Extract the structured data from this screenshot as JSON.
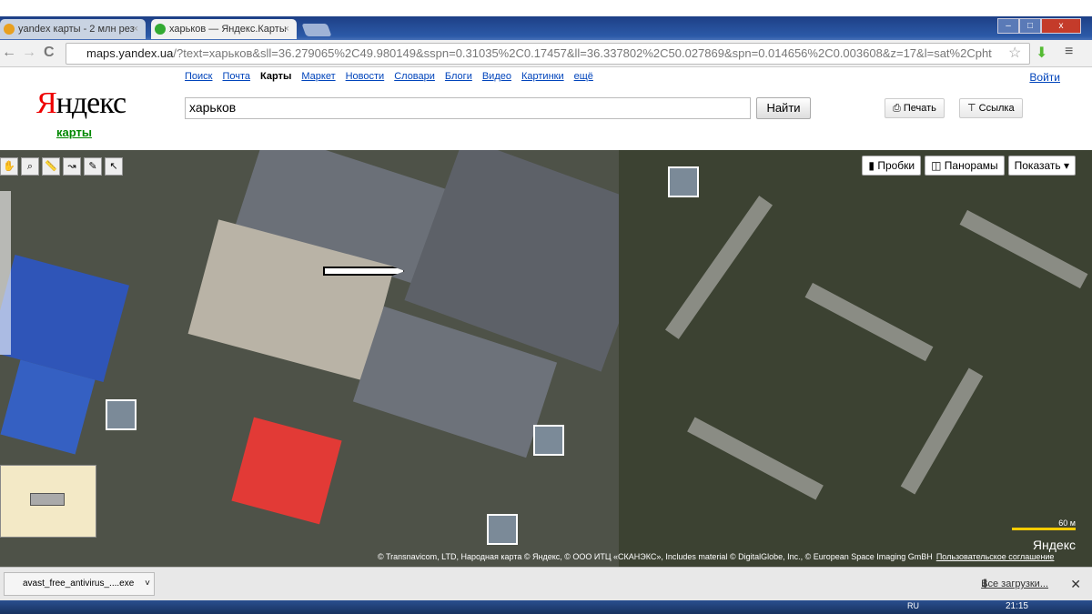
{
  "browser": {
    "tabs": [
      {
        "label": "yandex карты - 2 млн рез"
      },
      {
        "label": "харьков — Яндекс.Карты"
      }
    ],
    "url_host": "maps.yandex.ua",
    "url_rest": "/?text=харьков&sll=36.279065%2C49.980149&sspn=0.31035%2C0.17457&ll=36.337802%2C50.027869&spn=0.014656%2C0.003608&z=17&l=sat%2Cpht"
  },
  "header": {
    "logo": "Яндекс",
    "logo_first": "Я",
    "logo_rest": "ндекс",
    "subtitle": "карты",
    "services": [
      "Поиск",
      "Почта",
      "Карты",
      "Маркет",
      "Новости",
      "Словари",
      "Блоги",
      "Видео",
      "Картинки",
      "ещё"
    ],
    "login": "Войти",
    "search_value": "харьков",
    "find_label": "Найти",
    "print_label": "Печать",
    "link_label": "Ссылка"
  },
  "map": {
    "traffic_label": "Пробки",
    "panoramas_label": "Панорамы",
    "show_label": "Показать",
    "scale": "60 м",
    "brand": "Яндекс",
    "copyright": "© Transnavicom, LTD, Народная карта © Яндекс, © ООО ИТЦ «СКАНЭКС», Includes material © DigitalGlobe, Inc., © European Space Imaging GmBH",
    "agreement": "Пользовательское соглашение"
  },
  "downloads": {
    "file": "avast_free_antivirus_....exe",
    "all_label": "Все загрузки..."
  },
  "taskbar": {
    "lang": "RU",
    "time": "21:15"
  }
}
